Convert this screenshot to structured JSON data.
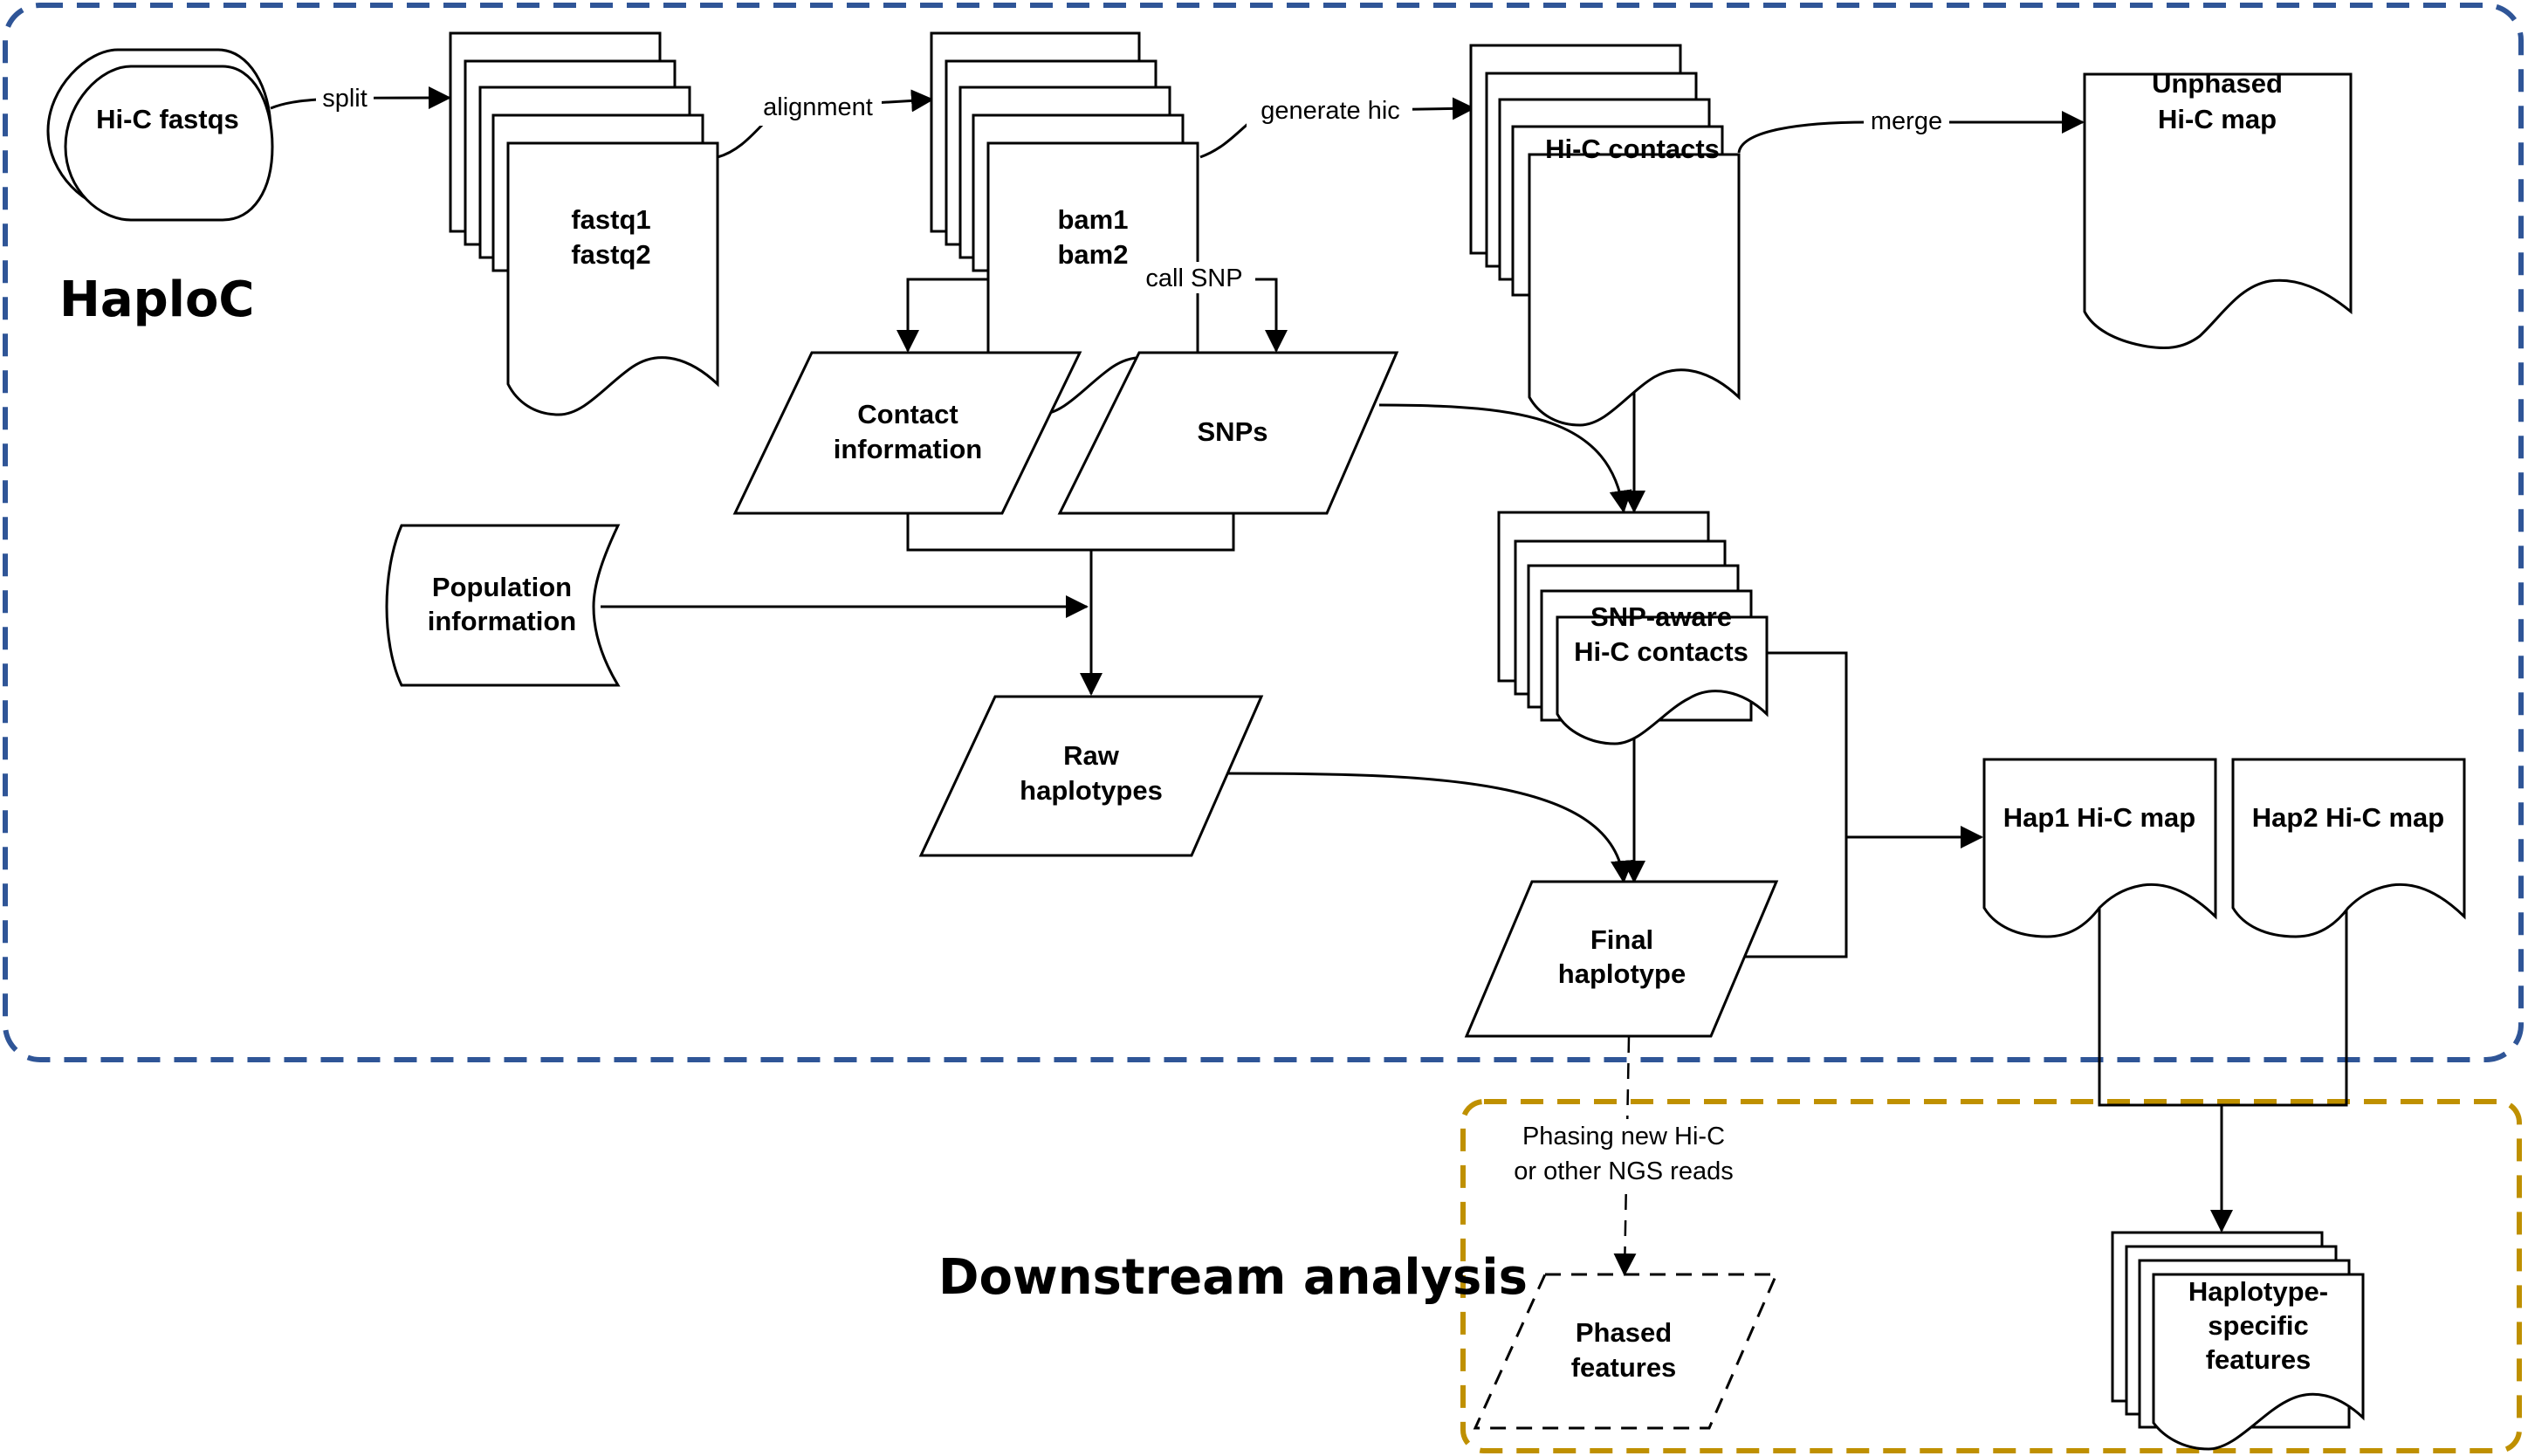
{
  "diagram": {
    "groups": [
      {
        "id": "haploc",
        "title": "HaploC",
        "border_color": "#2F5597",
        "style": "dashed"
      },
      {
        "id": "downstream",
        "title": "Downstream analysis",
        "border_color": "#BF9000",
        "style": "dashed"
      }
    ],
    "nodes": {
      "hic_fastqs": {
        "label": [
          "Hi-C fastqs"
        ],
        "shape": "stacked-stored-data"
      },
      "fastq_pairs": {
        "label": [
          "fastq1",
          "fastq2"
        ],
        "shape": "multi-document"
      },
      "bams": {
        "label": [
          "bam1",
          "bam2"
        ],
        "shape": "multi-document"
      },
      "hic_contacts": {
        "label": [
          "Hi-C contacts"
        ],
        "shape": "multi-document"
      },
      "unphased_map": {
        "label": [
          "Unphased",
          "Hi-C map"
        ],
        "shape": "document"
      },
      "contact_info": {
        "label": [
          "Contact",
          "information"
        ],
        "shape": "parallelogram"
      },
      "snps": {
        "label": [
          "SNPs"
        ],
        "shape": "parallelogram"
      },
      "population_info": {
        "label": [
          "Population",
          "information"
        ],
        "shape": "stored-data"
      },
      "snp_aware_contacts": {
        "label": [
          "SNP-aware",
          "Hi-C contacts"
        ],
        "shape": "multi-document"
      },
      "raw_haplotypes": {
        "label": [
          "Raw",
          "haplotypes"
        ],
        "shape": "parallelogram"
      },
      "final_haplotype": {
        "label": [
          "Final",
          "haplotype"
        ],
        "shape": "parallelogram"
      },
      "hap1_map": {
        "label": [
          "Hap1 Hi-C map"
        ],
        "shape": "document"
      },
      "hap2_map": {
        "label": [
          "Hap2 Hi-C map"
        ],
        "shape": "document"
      },
      "phased_features": {
        "label": [
          "Phased",
          "features"
        ],
        "shape": "parallelogram-dashed"
      },
      "haplotype_features": {
        "label": [
          "Haplotype-",
          "specific",
          "features"
        ],
        "shape": "multi-document"
      }
    },
    "edges": [
      {
        "from": "hic_fastqs",
        "to": "fastq_pairs",
        "label": "split"
      },
      {
        "from": "fastq_pairs",
        "to": "bams",
        "label": "alignment"
      },
      {
        "from": "bams",
        "to": "hic_contacts",
        "label": "generate hic"
      },
      {
        "from": "hic_contacts",
        "to": "unphased_map",
        "label": "merge"
      },
      {
        "from": "bams",
        "to": [
          "contact_info",
          "snps"
        ],
        "label": "call SNP"
      },
      {
        "from": "snps",
        "to": "snp_aware_contacts",
        "label": ""
      },
      {
        "from": "hic_contacts",
        "to": "snp_aware_contacts",
        "label": ""
      },
      {
        "from": [
          "contact_info",
          "snps"
        ],
        "to": "raw_haplotypes",
        "label": ""
      },
      {
        "from": "population_info",
        "to": "raw_haplotypes",
        "label": ""
      },
      {
        "from": "raw_haplotypes",
        "to": "final_haplotype",
        "label": ""
      },
      {
        "from": "snp_aware_contacts",
        "to": "final_haplotype",
        "label": ""
      },
      {
        "from": [
          "snp_aware_contacts",
          "final_haplotype"
        ],
        "to": "hap1_map",
        "label": ""
      },
      {
        "from": [
          "hap1_map",
          "hap2_map"
        ],
        "to": "haplotype_features",
        "label": ""
      },
      {
        "from": "final_haplotype",
        "to": "phased_features",
        "label": "Phasing new Hi-C or other NGS reads",
        "label_lines": [
          "Phasing new Hi-C",
          "or other NGS reads"
        ],
        "style": "dashed"
      }
    ]
  }
}
